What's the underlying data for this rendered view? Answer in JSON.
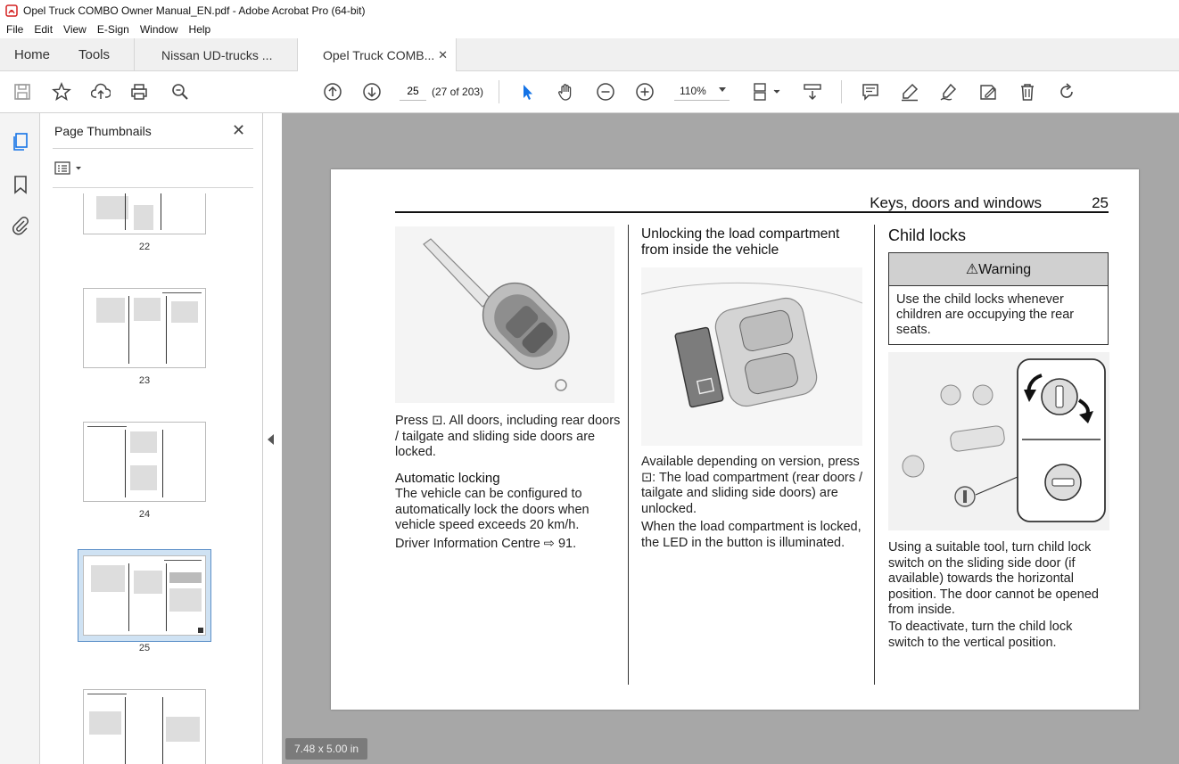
{
  "window": {
    "title": "Opel Truck COMBO Owner Manual_EN.pdf - Adobe Acrobat Pro (64-bit)"
  },
  "menu": [
    "File",
    "Edit",
    "View",
    "E-Sign",
    "Window",
    "Help"
  ],
  "tabs": {
    "home": "Home",
    "tools": "Tools",
    "doc1": "Nissan UD-trucks ...",
    "doc2": "Opel Truck COMB...",
    "close": "✕"
  },
  "toolbar": {
    "page_input": "25",
    "page_count": "(27 of 203)",
    "zoom": "110%"
  },
  "thumbnail_panel": {
    "title": "Page Thumbnails",
    "close": "✕",
    "thumbnails": [
      {
        "label": "22"
      },
      {
        "label": "23"
      },
      {
        "label": "24"
      },
      {
        "label": "25",
        "selected": true
      },
      {
        "label": ""
      }
    ]
  },
  "page_size": "7.48 x 5.00 in",
  "page": {
    "header_title": "Keys, doors and windows",
    "page_number": "25",
    "col1": {
      "press_text": "Press ⊡. All doors, including rear doors / tailgate and sliding side doors are locked.",
      "auto_heading": "Automatic locking",
      "auto_text": "The vehicle can be configured to automatically lock the doors when vehicle speed exceeds 20 km/h.",
      "dic_text": "Driver Information Centre ⇨ 91."
    },
    "col2": {
      "heading": "Unlocking the load compartment from inside the vehicle",
      "text1": "Available depending on version, press ⊡: The load compartment (rear doors / tailgate and sliding side doors) are unlocked.",
      "text2": "When the load compartment is locked, the LED in the button is illuminated."
    },
    "col3": {
      "heading": "Child locks",
      "warning_title": "⚠Warning",
      "warning_text": "Use the child locks whenever children are occupying the rear seats.",
      "text1": "Using a suitable tool, turn child lock switch on the sliding side door (if available) towards the horizontal position. The door cannot be opened from inside.",
      "text2": "To deactivate, turn the child lock switch to the vertical position."
    }
  },
  "colors": {
    "accent_blue": "#1473e6",
    "canvas_gray": "#a7a7a7",
    "app_icon_red": "#d42020"
  }
}
